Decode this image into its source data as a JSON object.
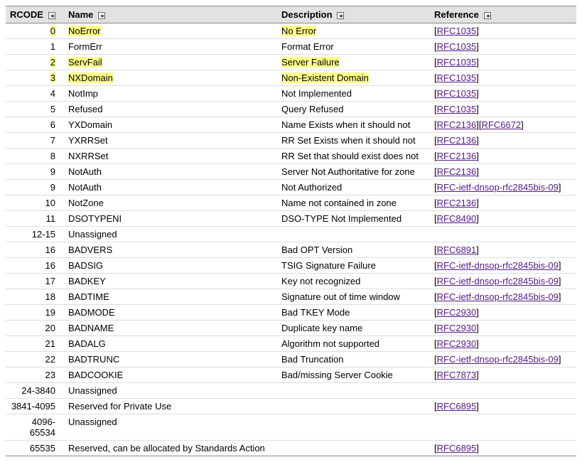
{
  "columns": {
    "rcode": "RCODE",
    "name": "Name",
    "desc": "Description",
    "ref": "Reference"
  },
  "rows": [
    {
      "rcode": "0",
      "name": "NoError",
      "desc": "No Error",
      "refs": [
        "RFC1035"
      ],
      "highlight": true
    },
    {
      "rcode": "1",
      "name": "FormErr",
      "desc": "Format Error",
      "refs": [
        "RFC1035"
      ],
      "highlight": false
    },
    {
      "rcode": "2",
      "name": "ServFail",
      "desc": "Server Failure",
      "refs": [
        "RFC1035"
      ],
      "highlight": true
    },
    {
      "rcode": "3",
      "name": "NXDomain",
      "desc": "Non-Existent Domain",
      "refs": [
        "RFC1035"
      ],
      "highlight": true
    },
    {
      "rcode": "4",
      "name": "NotImp",
      "desc": "Not Implemented",
      "refs": [
        "RFC1035"
      ],
      "highlight": false
    },
    {
      "rcode": "5",
      "name": "Refused",
      "desc": "Query Refused",
      "refs": [
        "RFC1035"
      ],
      "highlight": false
    },
    {
      "rcode": "6",
      "name": "YXDomain",
      "desc": "Name Exists when it should not",
      "refs": [
        "RFC2136",
        "RFC6672"
      ],
      "highlight": false
    },
    {
      "rcode": "7",
      "name": "YXRRSet",
      "desc": "RR Set Exists when it should not",
      "refs": [
        "RFC2136"
      ],
      "highlight": false
    },
    {
      "rcode": "8",
      "name": "NXRRSet",
      "desc": "RR Set that should exist does not",
      "refs": [
        "RFC2136"
      ],
      "highlight": false
    },
    {
      "rcode": "9",
      "name": "NotAuth",
      "desc": "Server Not Authoritative for zone",
      "refs": [
        "RFC2136"
      ],
      "highlight": false
    },
    {
      "rcode": "9",
      "name": "NotAuth",
      "desc": "Not Authorized",
      "refs": [
        "RFC-ietf-dnsop-rfc2845bis-09"
      ],
      "highlight": false
    },
    {
      "rcode": "10",
      "name": "NotZone",
      "desc": "Name not contained in zone",
      "refs": [
        "RFC2136"
      ],
      "highlight": false
    },
    {
      "rcode": "11",
      "name": "DSOTYPENI",
      "desc": "DSO-TYPE Not Implemented",
      "refs": [
        "RFC8490"
      ],
      "highlight": false
    },
    {
      "rcode": "12-15",
      "name": "Unassigned",
      "desc": "",
      "refs": [],
      "highlight": false
    },
    {
      "rcode": "16",
      "name": "BADVERS",
      "desc": "Bad OPT Version",
      "refs": [
        "RFC6891"
      ],
      "highlight": false
    },
    {
      "rcode": "16",
      "name": "BADSIG",
      "desc": "TSIG Signature Failure",
      "refs": [
        "RFC-ietf-dnsop-rfc2845bis-09"
      ],
      "highlight": false
    },
    {
      "rcode": "17",
      "name": "BADKEY",
      "desc": "Key not recognized",
      "refs": [
        "RFC-ietf-dnsop-rfc2845bis-09"
      ],
      "highlight": false
    },
    {
      "rcode": "18",
      "name": "BADTIME",
      "desc": "Signature out of time window",
      "refs": [
        "RFC-ietf-dnsop-rfc2845bis-09"
      ],
      "highlight": false
    },
    {
      "rcode": "19",
      "name": "BADMODE",
      "desc": "Bad TKEY Mode",
      "refs": [
        "RFC2930"
      ],
      "highlight": false
    },
    {
      "rcode": "20",
      "name": "BADNAME",
      "desc": "Duplicate key name",
      "refs": [
        "RFC2930"
      ],
      "highlight": false
    },
    {
      "rcode": "21",
      "name": "BADALG",
      "desc": "Algorithm not supported",
      "refs": [
        "RFC2930"
      ],
      "highlight": false
    },
    {
      "rcode": "22",
      "name": "BADTRUNC",
      "desc": "Bad Truncation",
      "refs": [
        "RFC-ietf-dnsop-rfc2845bis-09"
      ],
      "highlight": false
    },
    {
      "rcode": "23",
      "name": "BADCOOKIE",
      "desc": "Bad/missing Server Cookie",
      "refs": [
        "RFC7873"
      ],
      "highlight": false
    },
    {
      "rcode": "24-3840",
      "name": "Unassigned",
      "desc": "",
      "refs": [],
      "highlight": false
    },
    {
      "rcode": "3841-4095",
      "name": "Reserved for Private Use",
      "desc": "",
      "refs": [
        "RFC6895"
      ],
      "highlight": false
    },
    {
      "rcode": "4096-65534",
      "name": "Unassigned",
      "desc": "",
      "refs": [],
      "highlight": false
    },
    {
      "rcode": "65535",
      "name": "Reserved, can be allocated by Standards Action",
      "desc": "",
      "refs": [
        "RFC6895"
      ],
      "highlight": false
    }
  ]
}
